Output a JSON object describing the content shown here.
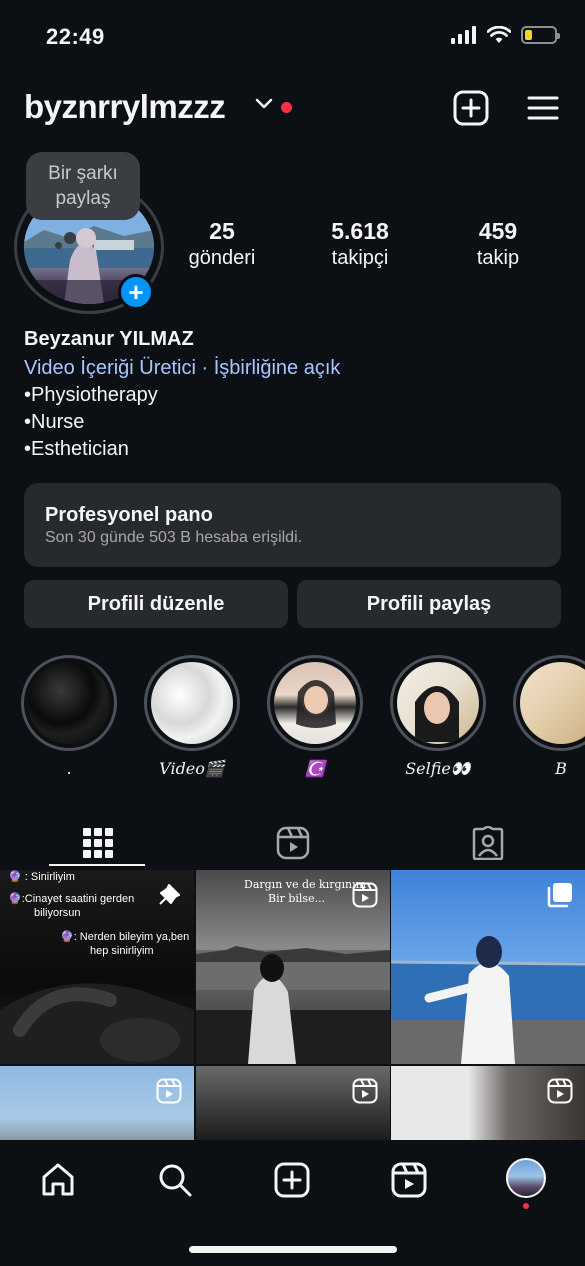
{
  "status_bar": {
    "time": "22:49",
    "battery_level": 0.25,
    "battery_color": "#f7d02c"
  },
  "header": {
    "username": "byznrrylmzzz",
    "icons": [
      "chevron-down-icon",
      "notification-dot",
      "create-icon",
      "menu-icon"
    ]
  },
  "note": {
    "line1": "Bir şarkı",
    "line2": "paylaş"
  },
  "stats": [
    {
      "value": "25",
      "label": "gönderi"
    },
    {
      "value": "5.618",
      "label": "takipçi"
    },
    {
      "value": "459",
      "label": "takip"
    }
  ],
  "bio": {
    "name": "Beyzanur YILMAZ",
    "category": "Video İçeriği Üretici · İşbirliğine açık",
    "lines": [
      "•Physiotherapy",
      "•Nurse",
      "•Esthetician"
    ]
  },
  "dashboard": {
    "title": "Profesyonel pano",
    "subtitle": "Son 30 günde 503 B hesaba erişildi."
  },
  "buttons": {
    "edit": "Profili düzenle",
    "share": "Profili paylaş"
  },
  "highlights": [
    {
      "label": "."
    },
    {
      "label": "Video🎬"
    },
    {
      "label": "☪️"
    },
    {
      "label": "Selfie👀"
    },
    {
      "label": "B"
    }
  ],
  "tabs": [
    "grid-icon",
    "reels-icon",
    "tagged-icon"
  ],
  "posts": {
    "p1": {
      "line0": "🔮 : Sinirliyim",
      "line1": "🔮:Cinayet saatini gerden",
      "line2": "biliyorsun",
      "line3": "🔮: Nerden bileyim ya,ben",
      "line4": "hep sinirliyim"
    },
    "p2": {
      "line1": "Dargın ve de kırgınım",
      "line2": "Bir bilse..."
    }
  },
  "bottom_nav": [
    "home-icon",
    "search-icon",
    "create-icon",
    "reels-icon",
    "profile-avatar"
  ],
  "colors": {
    "background": "#0c1014",
    "surface": "#262a2e",
    "accent": "#0095f6",
    "link": "#a8c7ff",
    "alert": "#ff3040"
  }
}
